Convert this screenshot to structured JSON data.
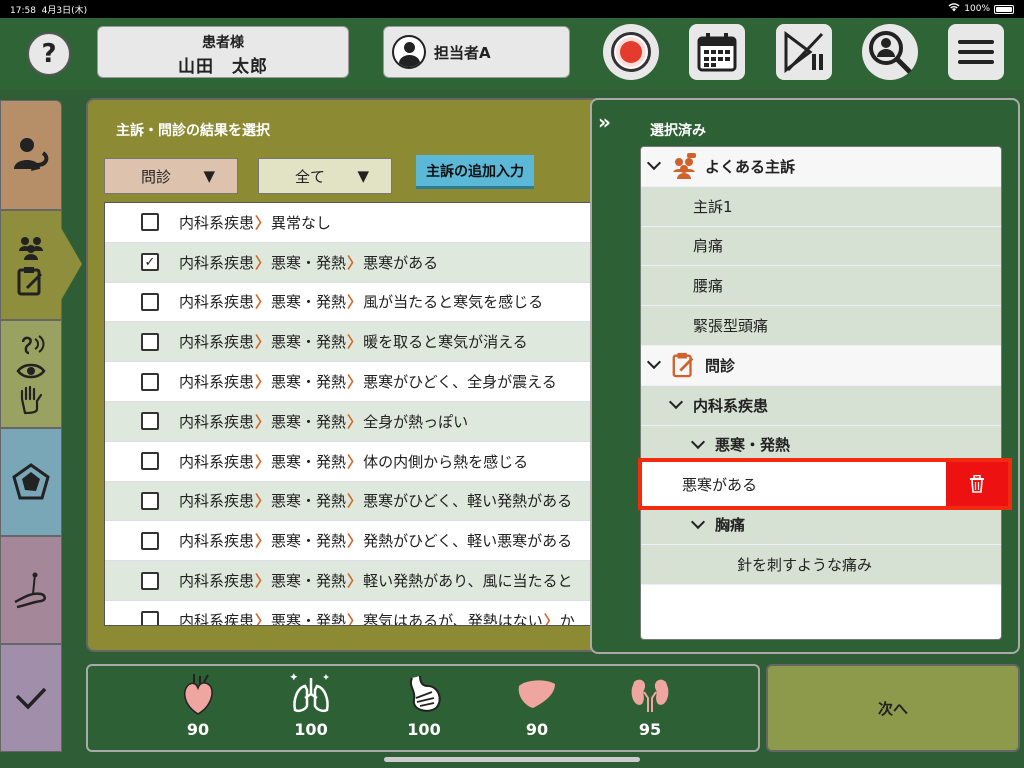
{
  "status_bar": {
    "time": "17:58",
    "date": "4月3日(木)",
    "battery": "100%"
  },
  "header": {
    "help_label": "?",
    "patient_label": "患者様",
    "patient_name": "山田　太郎",
    "staff_name": "担当者A"
  },
  "main": {
    "title": "主訴・問診の結果を選択",
    "filter1": "問診",
    "filter2": "全て",
    "add_button": "主訴の追加入力",
    "rows": [
      {
        "checked": false,
        "cat": "内科系疾患",
        "sub": "",
        "item": "異常なし",
        "more": ""
      },
      {
        "checked": true,
        "cat": "内科系疾患",
        "sub": "悪寒・発熱",
        "item": "悪寒がある",
        "more": ""
      },
      {
        "checked": false,
        "cat": "内科系疾患",
        "sub": "悪寒・発熱",
        "item": "風が当たると寒気を感じる",
        "more": ""
      },
      {
        "checked": false,
        "cat": "内科系疾患",
        "sub": "悪寒・発熱",
        "item": "暖を取ると寒気が消える",
        "more": ""
      },
      {
        "checked": false,
        "cat": "内科系疾患",
        "sub": "悪寒・発熱",
        "item": "悪寒がひどく、全身が震える",
        "more": ""
      },
      {
        "checked": false,
        "cat": "内科系疾患",
        "sub": "悪寒・発熱",
        "item": "全身が熱っぽい",
        "more": ""
      },
      {
        "checked": false,
        "cat": "内科系疾患",
        "sub": "悪寒・発熱",
        "item": "体の内側から熱を感じる",
        "more": ""
      },
      {
        "checked": false,
        "cat": "内科系疾患",
        "sub": "悪寒・発熱",
        "item": "悪寒がひどく、軽い発熱がある",
        "more": ""
      },
      {
        "checked": false,
        "cat": "内科系疾患",
        "sub": "悪寒・発熱",
        "item": "発熱がひどく、軽い悪寒がある",
        "more": ""
      },
      {
        "checked": false,
        "cat": "内科系疾患",
        "sub": "悪寒・発熱",
        "item": "軽い発熱があり、風に当たると",
        "more": ""
      },
      {
        "checked": false,
        "cat": "内科系疾患",
        "sub": "悪寒・発熱",
        "item": "寒気はあるが、発熱はない",
        "more": "か"
      }
    ]
  },
  "selected": {
    "title": "選択済み",
    "collapse_label": "»",
    "common_header": "よくある主訴",
    "common_items": [
      "主訴1",
      "肩痛",
      "腰痛",
      "緊張型頭痛"
    ],
    "monshin_header": "問診",
    "cat1": "内科系疾患",
    "sub1": "悪寒・発熱",
    "sub1_item": "悪寒がある",
    "sub2": "胸痛",
    "sub2_item": "針を刺すような痛み"
  },
  "vitals": [
    {
      "icon": "heart-icon",
      "value": "90"
    },
    {
      "icon": "lungs-icon",
      "value": "100"
    },
    {
      "icon": "stomach-icon",
      "value": "100"
    },
    {
      "icon": "liver-icon",
      "value": "90"
    },
    {
      "icon": "kidney-icon",
      "value": "95"
    }
  ],
  "next_button": "次へ",
  "colors": {
    "header_green": "#2f6436",
    "highlight_red": "#f22a0f",
    "trash_red": "#ee1111",
    "accent_blue": "#5bb8d6"
  }
}
